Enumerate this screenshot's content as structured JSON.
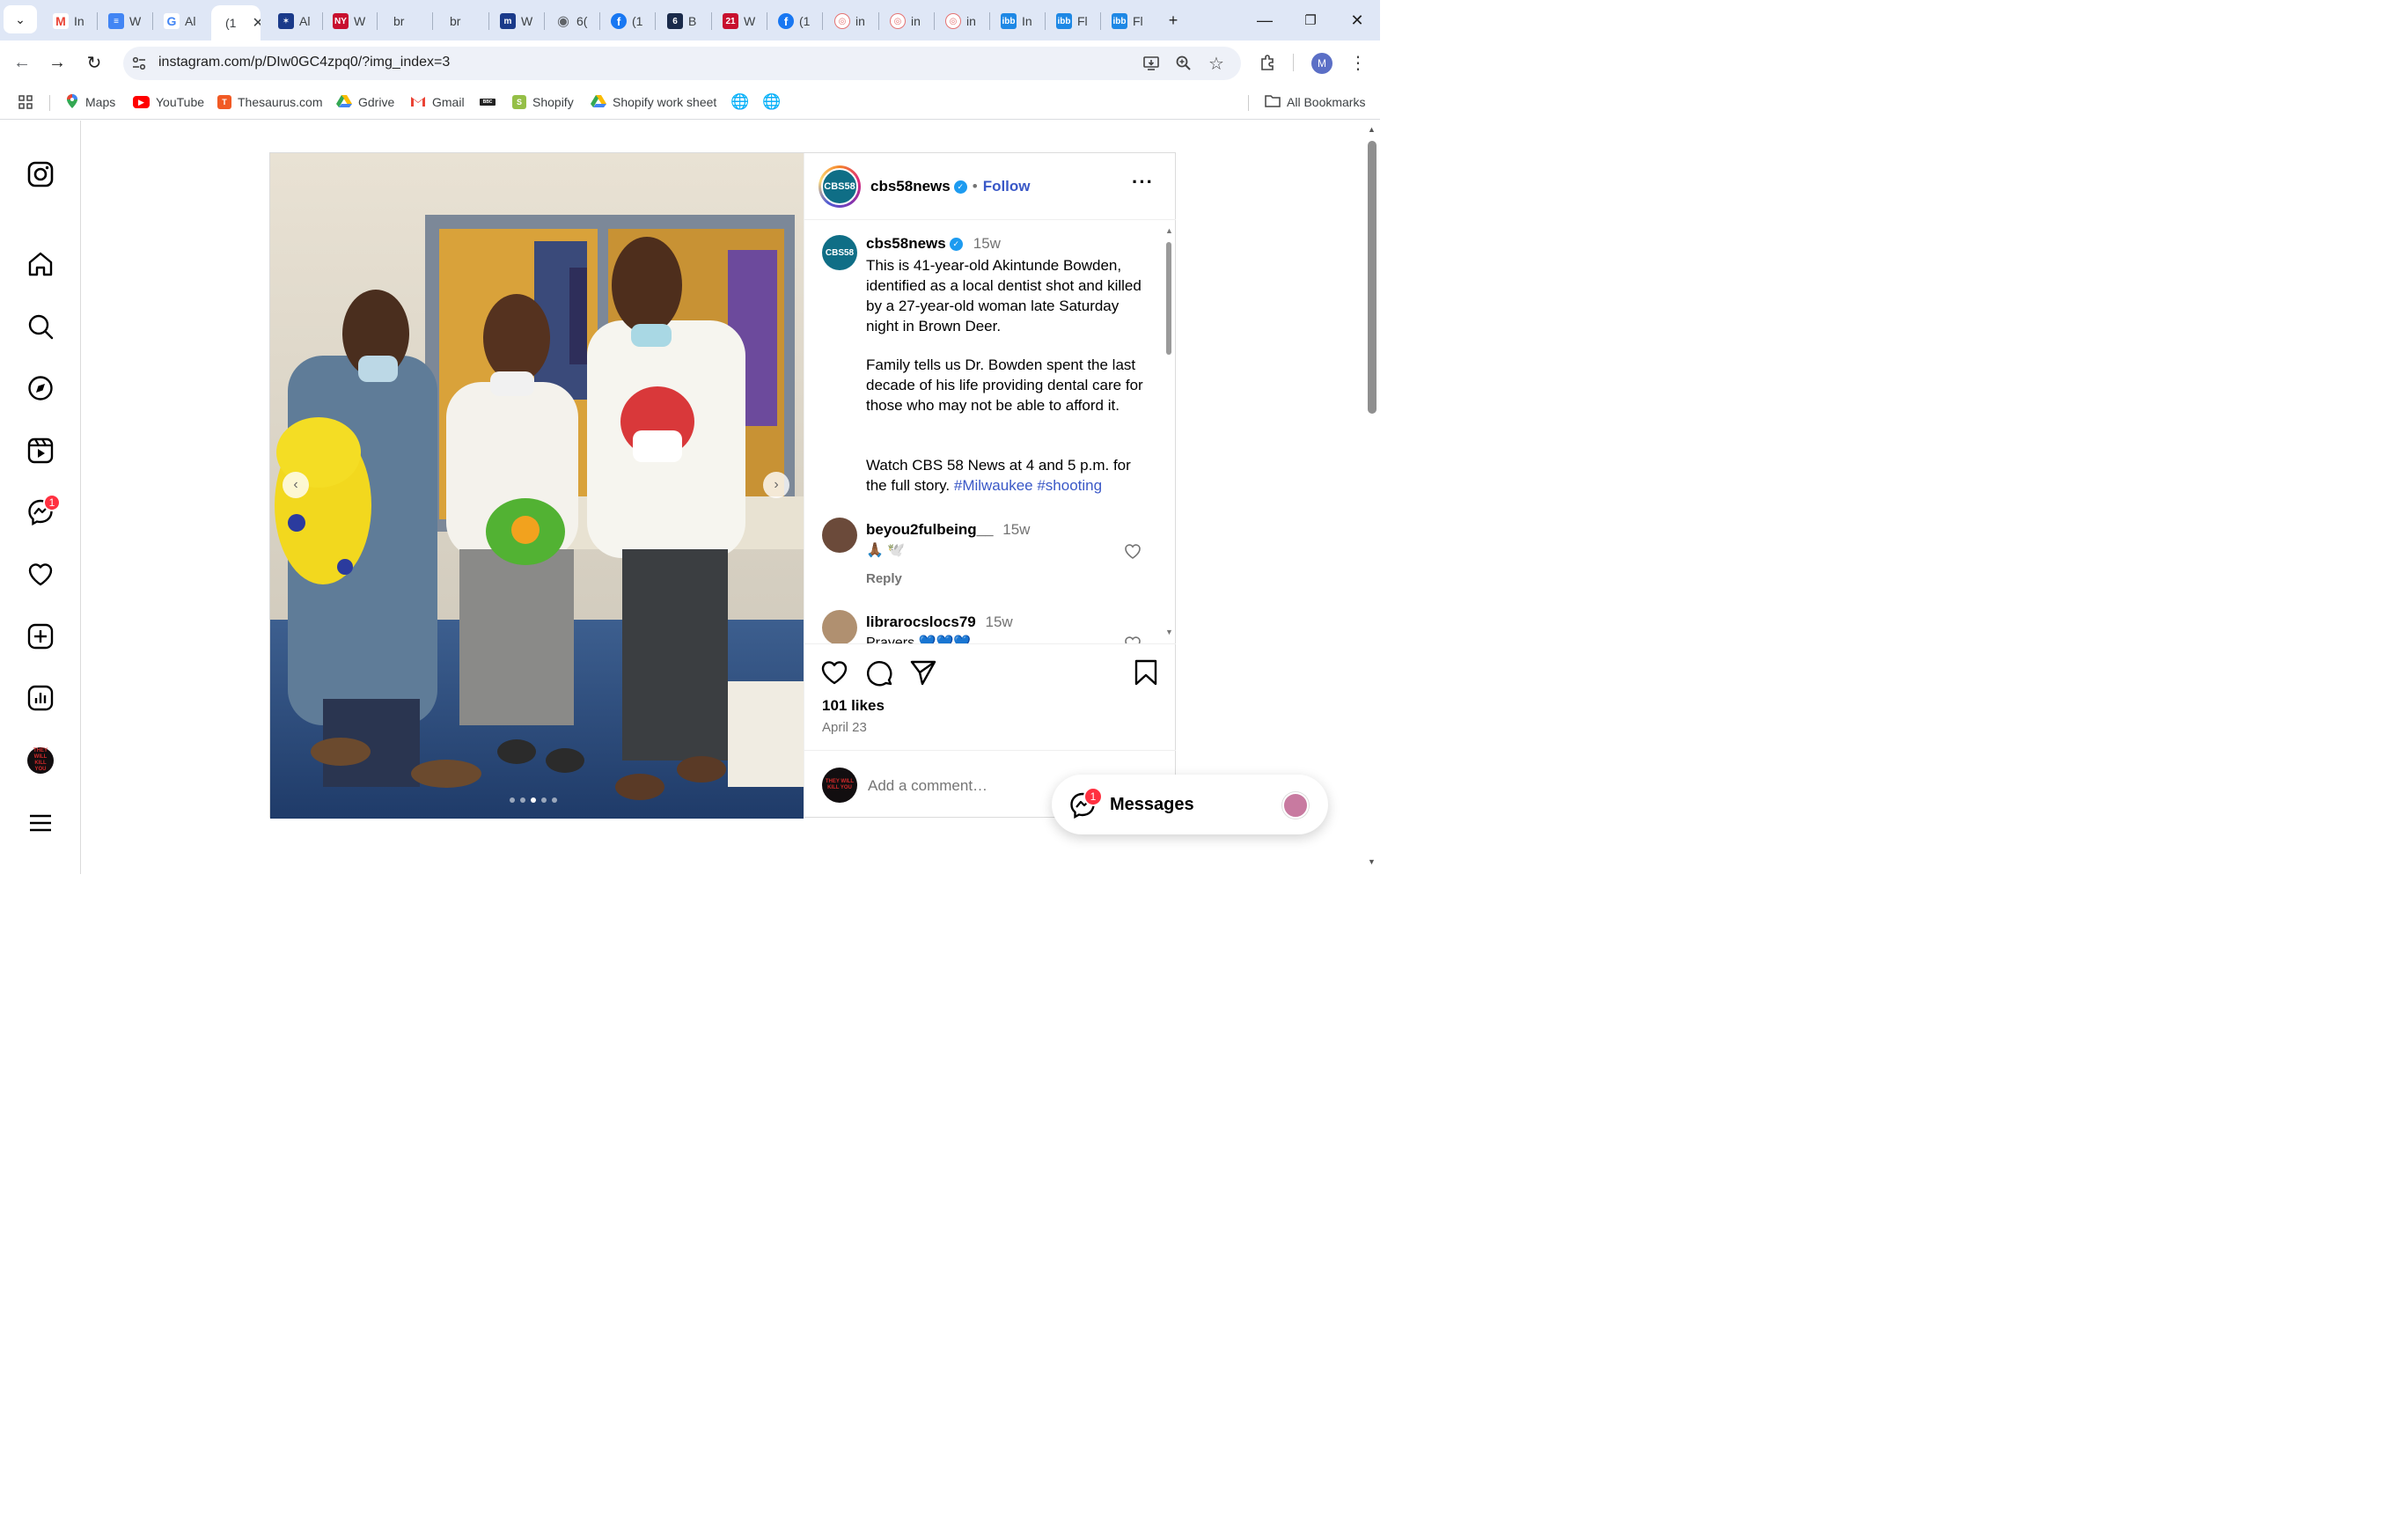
{
  "browser": {
    "tabs": [
      {
        "label": "In",
        "icon": "gmail-icon",
        "color": "#ea4335"
      },
      {
        "label": "W",
        "icon": "docs-icon",
        "color": "#4285f4"
      },
      {
        "label": "Al",
        "icon": "google-icon",
        "color": "#4285f4"
      },
      {
        "label": "(1",
        "icon": "instagram-icon",
        "color": "#000000",
        "active": true
      },
      {
        "label": "Al",
        "icon": "news-icon",
        "color": "#1a3a8a"
      },
      {
        "label": "W",
        "icon": "nypost-icon",
        "color": "#c8102e"
      },
      {
        "label": "br",
        "icon": "blank-icon",
        "color": "#ffffff"
      },
      {
        "label": "br",
        "icon": "blank-icon",
        "color": "#ffffff"
      },
      {
        "label": "W",
        "icon": "m-icon",
        "color": "#1a3a8a"
      },
      {
        "label": "6(",
        "icon": "globe-icon",
        "color": "#5f6368"
      },
      {
        "label": "(1",
        "icon": "facebook-icon",
        "color": "#1877f2"
      },
      {
        "label": "B",
        "icon": "fox6-icon",
        "color": "#1a2a4a"
      },
      {
        "label": "W",
        "icon": "21-icon",
        "color": "#c8102e"
      },
      {
        "label": "(1",
        "icon": "facebook-icon",
        "color": "#1877f2"
      },
      {
        "label": "in",
        "icon": "shield-icon",
        "color": "#e57373"
      },
      {
        "label": "in",
        "icon": "shield-icon",
        "color": "#e57373"
      },
      {
        "label": "in",
        "icon": "shield-icon",
        "color": "#e57373"
      },
      {
        "label": "In",
        "icon": "ibb-icon",
        "color": "#1e88e5"
      },
      {
        "label": "Fl",
        "icon": "ibb-icon",
        "color": "#1e88e5"
      },
      {
        "label": "Fl",
        "icon": "ibb-icon",
        "color": "#1e88e5"
      }
    ],
    "url": "instagram.com/p/DIw0GC4zpq0/?img_index=3",
    "profile_initial": "M",
    "bookmarks": [
      {
        "label": "Maps",
        "icon": "maps-icon"
      },
      {
        "label": "YouTube",
        "icon": "youtube-icon"
      },
      {
        "label": "Thesaurus.com",
        "icon": "thesaurus-icon"
      },
      {
        "label": "Gdrive",
        "icon": "drive-icon"
      },
      {
        "label": "Gmail",
        "icon": "gmail-icon"
      },
      {
        "label": "",
        "icon": "bbc-icon"
      },
      {
        "label": "Shopify",
        "icon": "shopify-icon"
      },
      {
        "label": "Shopify work sheet",
        "icon": "drive-icon"
      },
      {
        "label": "",
        "icon": "globe-icon"
      },
      {
        "label": "",
        "icon": "globe-icon"
      }
    ],
    "all_bookmarks": "All Bookmarks"
  },
  "rail": {
    "notification_count": "1",
    "avatar_text": "THEY WILL KILL YOU"
  },
  "post": {
    "username": "cbs58news",
    "follow_label": "Follow",
    "logo_text": "CBS58",
    "caption": {
      "time": "15w",
      "paragraphs": [
        "This is 41-year-old Akintunde Bowden, identified as a local dentist shot and killed by a 27-year-old woman late Saturday night in Brown Deer.",
        "Family tells us Dr. Bowden spent the last decade of his life providing dental care for those who may not be able to afford it.",
        "Watch CBS 58 News at 4 and 5 p.m. for the full story."
      ],
      "hashtags": "#Milwaukee #shooting"
    },
    "comments": [
      {
        "user": "beyou2fulbeing__",
        "time": "15w",
        "text": "🙏🏾 🕊️",
        "reply": "Reply"
      },
      {
        "user": "librarocslocs79",
        "time": "15w",
        "text": "Prayers 💙💙💙"
      }
    ],
    "likes": "101 likes",
    "date": "April 23",
    "add_comment_placeholder": "Add a comment…",
    "carousel": {
      "count": 5,
      "active_index": 2
    }
  },
  "messages": {
    "label": "Messages",
    "badge": "1"
  }
}
